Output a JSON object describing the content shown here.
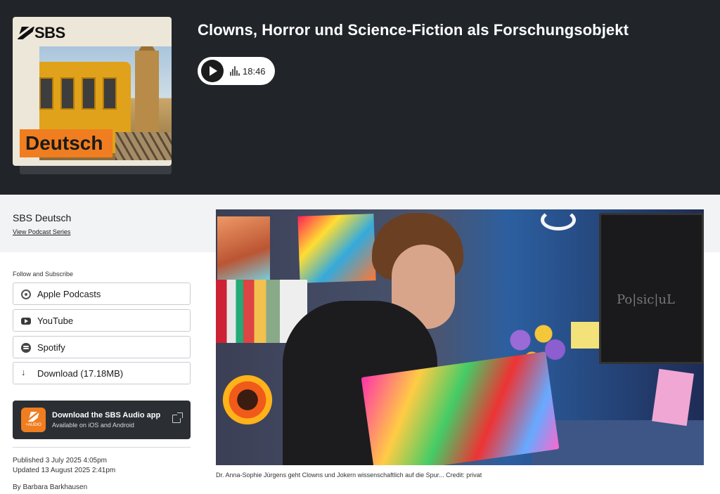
{
  "cover": {
    "logo": "SBS",
    "label": "Deutsch"
  },
  "episode": {
    "title": "Clowns, Horror und Science-Fiction als Forschungsobjekt",
    "duration": "18:46"
  },
  "series": {
    "name": "SBS Deutsch",
    "link": "View Podcast Series"
  },
  "follow": {
    "label": "Follow and Subscribe",
    "items": [
      {
        "label": "Apple Podcasts",
        "icon": "podcast-icon"
      },
      {
        "label": "YouTube",
        "icon": "youtube-icon"
      },
      {
        "label": "Spotify",
        "icon": "spotify-icon"
      },
      {
        "label": "Download (17.18MB)",
        "icon": "download-icon"
      }
    ]
  },
  "app_banner": {
    "icon_text": "+AUDIO",
    "title": "Download the SBS Audio app",
    "subtitle": "Available on iOS and Android"
  },
  "meta": {
    "published": "Published 3 July 2025 4:05pm",
    "updated": "Updated 13 August 2025 2:41pm",
    "author": "By Barbara Barkhausen"
  },
  "photo": {
    "monitor_text": "Po|sic|uL",
    "caption": "Dr. Anna-Sophie Jürgens geht Clowns und Jokern wissenschaftlich auf die Spur... Credit: privat"
  },
  "colors": {
    "hero_bg": "#212529",
    "accent_orange": "#f07d1f",
    "band_bg": "#f2f3f5"
  }
}
